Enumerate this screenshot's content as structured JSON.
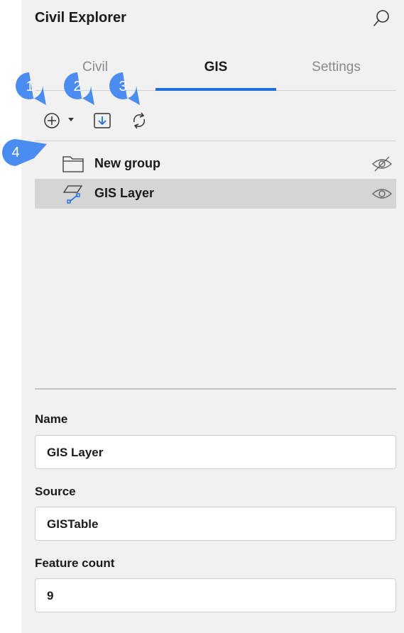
{
  "app": {
    "title": "Civil Explorer"
  },
  "tabs": [
    {
      "label": "Civil"
    },
    {
      "label": "GIS"
    },
    {
      "label": "Settings"
    }
  ],
  "active_tab": "GIS",
  "callouts": [
    "1",
    "2",
    "3",
    "4"
  ],
  "toolbar": {
    "add_icon": "plus-circle-icon",
    "dropdown_icon": "caret-down-icon",
    "import_icon": "import-arrow-icon",
    "refresh_icon": "refresh-icon"
  },
  "tree": [
    {
      "label": "New group",
      "icon": "folder-icon",
      "visibility": "hidden-eye-icon",
      "selected": false
    },
    {
      "label": "GIS Layer",
      "icon": "gis-layer-icon",
      "visibility": "eye-icon",
      "selected": true
    }
  ],
  "properties": {
    "name_label": "Name",
    "name_value": "GIS Layer",
    "source_label": "Source",
    "source_value": "GISTable",
    "feature_count_label": "Feature count",
    "feature_count_value": "9"
  },
  "colors": {
    "accent": "#1e6fe0",
    "badge": "#4a8cf0",
    "panel": "#f1f1f1",
    "selected_row": "#d5d5d5"
  }
}
